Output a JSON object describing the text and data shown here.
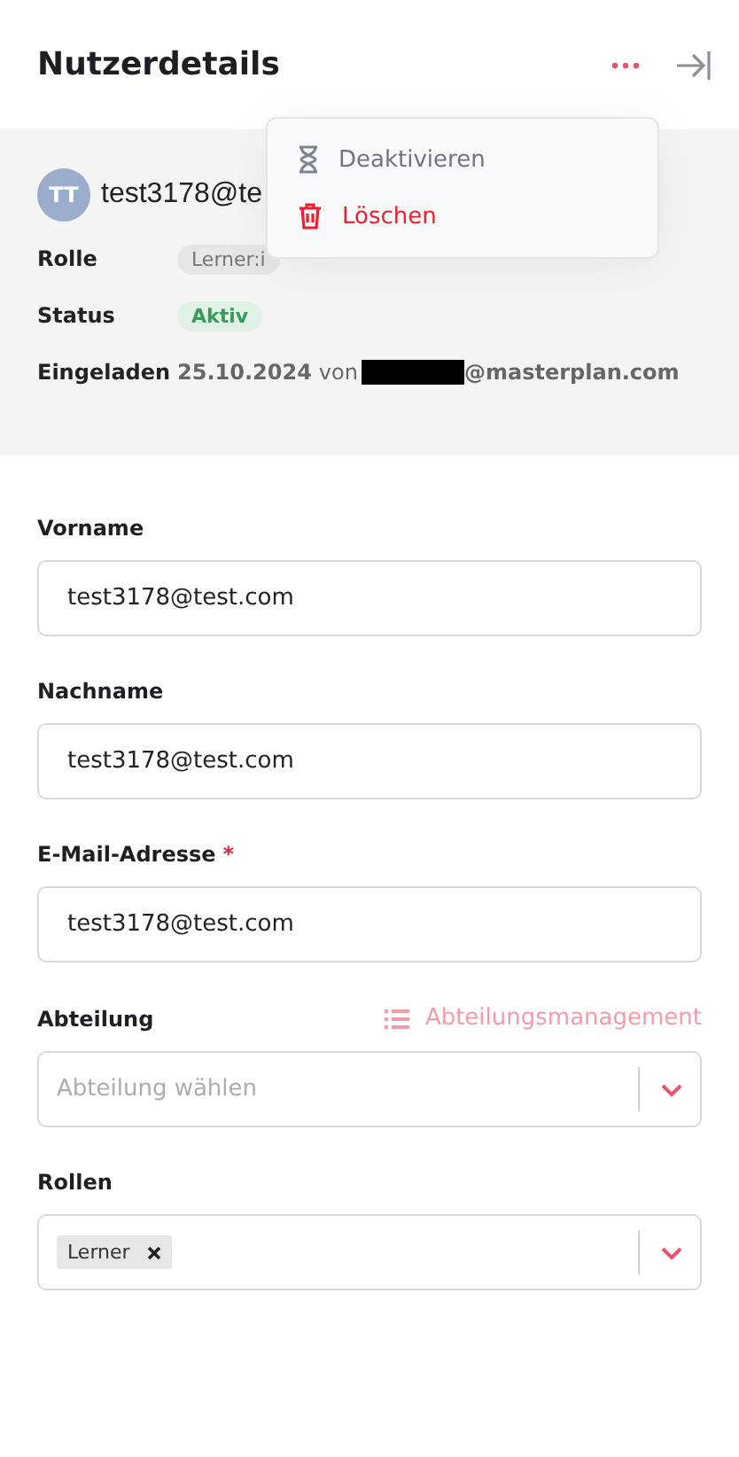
{
  "header": {
    "title": "Nutzerdetails"
  },
  "menu": {
    "items": [
      {
        "label": "Deaktivieren",
        "kind": "neutral"
      },
      {
        "label": "Löschen",
        "kind": "danger"
      }
    ]
  },
  "user": {
    "initials": "TT",
    "name": "test3178@te",
    "role_label": "Rolle",
    "role": "Lerner:i",
    "status_label": "Status",
    "status": "Aktiv",
    "invited_label": "Eingeladen",
    "invited_date": "25.10.2024",
    "invited_by_prefix": "von",
    "invited_by_suffix": "@masterplan.com"
  },
  "fields": [
    {
      "label": "Vorname",
      "kind": "text",
      "value": "test3178@test.com"
    },
    {
      "label": "Nachname",
      "kind": "text",
      "value": "test3178@test.com"
    },
    {
      "label": "E-Mail-Adresse",
      "kind": "text",
      "required_mark": "*",
      "value": "test3178@test.com"
    },
    {
      "label": "Abteilung",
      "kind": "select",
      "link": "Abteilungsmanagement",
      "placeholder": "Abteilung wählen"
    },
    {
      "label": "Rollen",
      "kind": "multiselect",
      "tags": [
        "Lerner"
      ]
    }
  ]
}
